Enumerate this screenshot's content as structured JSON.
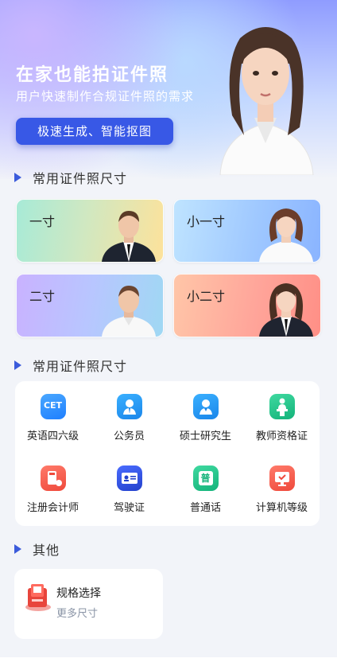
{
  "hero": {
    "title": "在家也能拍证件照",
    "subtitle": "用户快速制作合规证件照的需求",
    "button_label": "极速生成、智能抠图"
  },
  "sections": {
    "sizes_title": "常用证件照尺寸",
    "categories_title": "常用证件照尺寸",
    "other_title": "其他"
  },
  "sizes": [
    {
      "label": "一寸"
    },
    {
      "label": "小一寸"
    },
    {
      "label": "二寸"
    },
    {
      "label": "小二寸"
    }
  ],
  "categories": [
    {
      "label": "英语四六级",
      "icon_text": "CET",
      "icon": "cet-icon"
    },
    {
      "label": "公务员",
      "icon": "civil-servant-icon"
    },
    {
      "label": "硕士研究生",
      "icon": "graduate-student-icon"
    },
    {
      "label": "教师资格证",
      "icon": "teacher-icon"
    },
    {
      "label": "注册会计师",
      "icon": "accountant-icon"
    },
    {
      "label": "驾驶证",
      "icon": "driver-license-icon"
    },
    {
      "label": "普通话",
      "icon_text": "普",
      "icon": "mandarin-icon"
    },
    {
      "label": "计算机等级",
      "icon": "computer-icon"
    }
  ],
  "other": {
    "title": "规格选择",
    "subtitle": "更多尺寸",
    "icon": "photo-spec-icon"
  },
  "colors": {
    "accent": "#3858e6",
    "cet": "#2a8cff",
    "blue": "#1e8fe8",
    "green": "#1fc28a",
    "red": "#f25a4a",
    "navy": "#2d4fd6"
  }
}
